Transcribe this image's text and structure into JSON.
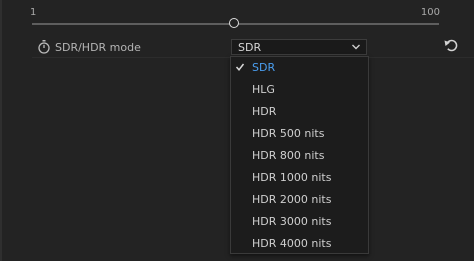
{
  "slider": {
    "min_label": "1",
    "max_label": "100",
    "value_fraction": 0.5
  },
  "property": {
    "label": "SDR/HDR mode",
    "stopwatch_icon": "stopwatch-icon",
    "reset_icon": "reset-icon"
  },
  "select": {
    "value": "SDR",
    "chevron_icon": "chevron-down-icon"
  },
  "dropdown": {
    "selected_index": 0,
    "options": [
      {
        "label": "SDR"
      },
      {
        "label": "HLG"
      },
      {
        "label": "HDR"
      },
      {
        "label": "HDR 500 nits"
      },
      {
        "label": "HDR 800 nits"
      },
      {
        "label": "HDR 1000 nits"
      },
      {
        "label": "HDR 2000 nits"
      },
      {
        "label": "HDR 3000 nits"
      },
      {
        "label": "HDR 4000 nits"
      }
    ]
  },
  "colors": {
    "background": "#232323",
    "selected_text": "#4a9ef0",
    "text": "#cfcfcf"
  }
}
